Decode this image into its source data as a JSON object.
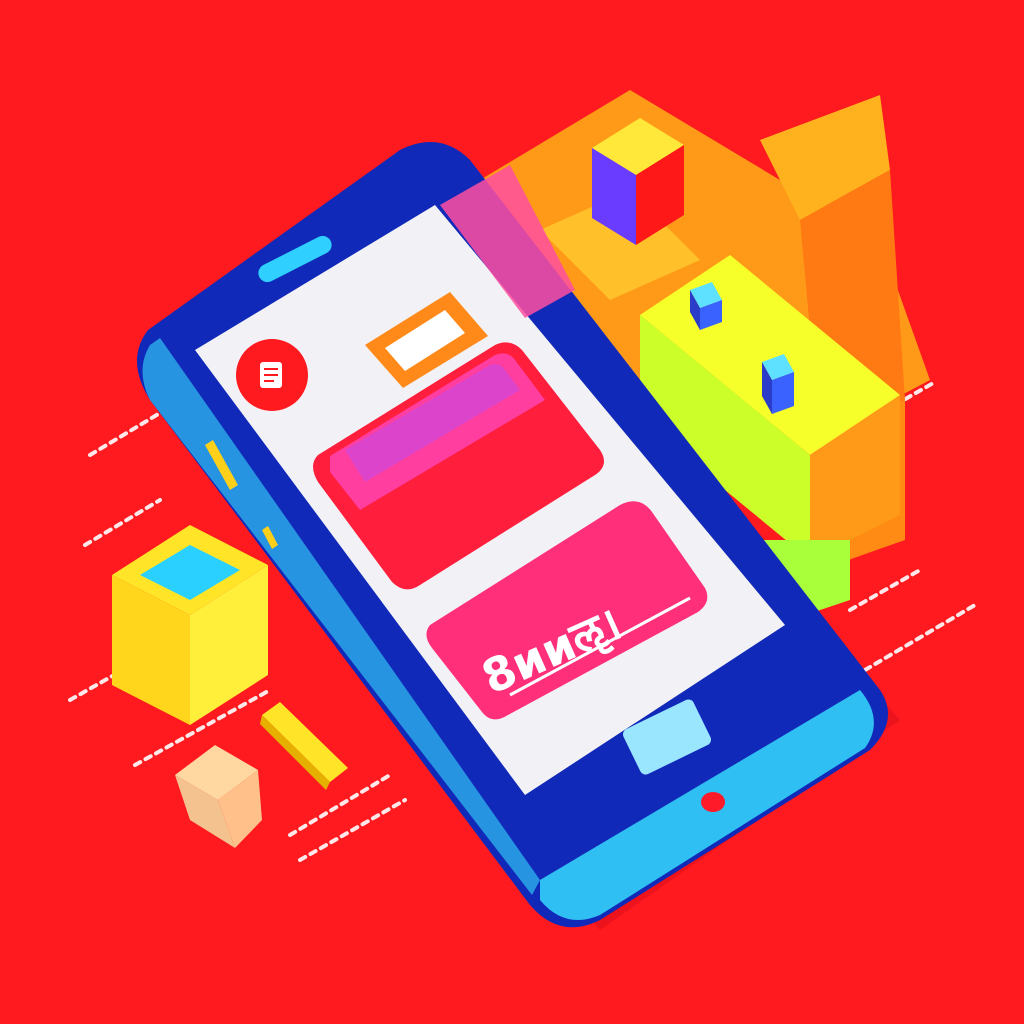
{
  "colors": {
    "background": "#ff1a1f",
    "phone_body": "#1029b8",
    "phone_bezel_light": "#2fb8f0",
    "screen": "#f2f2f6",
    "accent_pink": "#ff2f7a",
    "accent_orange": "#ff8a1a",
    "block_yellow": "#f6ff1e",
    "block_green": "#b8ff2a"
  },
  "icons": {
    "document": "document-icon",
    "speaker": "speaker-slot-icon",
    "home": "home-button-icon"
  },
  "screen": {
    "button_text": "8ииॡ।"
  }
}
